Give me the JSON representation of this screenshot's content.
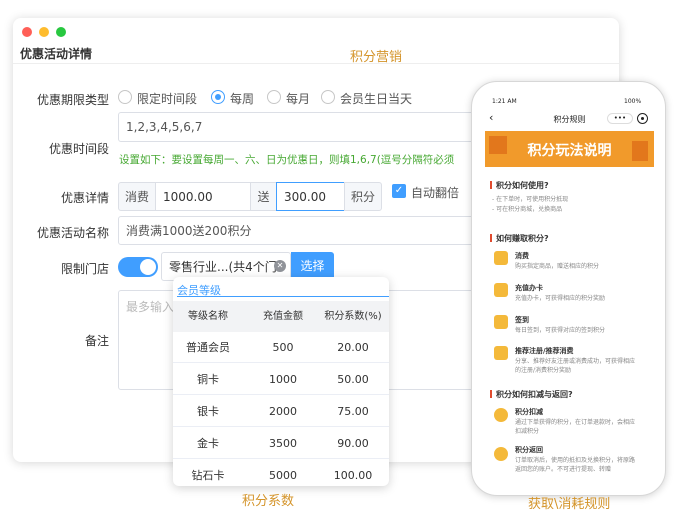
{
  "window": {
    "title": "优惠活动详情",
    "dots": [
      "#ff5f57",
      "#febc2e",
      "#28c840"
    ]
  },
  "captions": {
    "top": "积分营销",
    "coef": "积分系数",
    "rules": "获取\\消耗规则"
  },
  "form": {
    "period_type": {
      "label": "优惠期限类型",
      "options": [
        "限定时间段",
        "每周",
        "每月",
        "会员生日当天"
      ],
      "selected": "每周"
    },
    "time": {
      "label": "优惠时间段",
      "value": "1,2,3,4,5,6,7",
      "hint": "设置如下：要设置每周一、六、日为优惠日，则填1,6,7(逗号分隔符必须"
    },
    "detail": {
      "label": "优惠详情",
      "consume_label": "消费",
      "consume_value": "1000.00",
      "give_label": "送",
      "give_value": "300.00",
      "unit_label": "积分",
      "auto_double_label": "自动翻倍",
      "auto_double_checked": true
    },
    "name": {
      "label": "优惠活动名称",
      "value": "消费满1000送200积分"
    },
    "store": {
      "label": "限制门店",
      "value": "零售行业...(共4个门",
      "select_label": "选择",
      "enabled": true
    },
    "remark": {
      "label": "备注",
      "placeholder": "最多输入"
    }
  },
  "member_level": {
    "title": "会员等级",
    "headers": [
      "等级名称",
      "充值金额",
      "积分系数(%)"
    ],
    "rows": [
      [
        "普通会员",
        "500",
        "20.00"
      ],
      [
        "铜卡",
        "1000",
        "50.00"
      ],
      [
        "银卡",
        "2000",
        "75.00"
      ],
      [
        "金卡",
        "3500",
        "90.00"
      ],
      [
        "钻石卡",
        "5000",
        "100.00"
      ]
    ]
  },
  "phone": {
    "time": "1:21 AM",
    "battery": "100%",
    "nav_title": "积分规则",
    "banner": "积分玩法说明",
    "s1": {
      "title": "积分如何使用?",
      "lines": [
        "- 在下单时，可使用积分抵现",
        "- 可在积分商城，兑换商品"
      ]
    },
    "s2": {
      "title": "如何赚取积分?",
      "items": [
        {
          "title": "消费",
          "desc": [
            "购买指定商品，赠送相应的积分"
          ]
        },
        {
          "title": "充值办卡",
          "desc": [
            "充值办卡，可获得相应的积分奖励"
          ]
        },
        {
          "title": "签到",
          "desc": [
            "每日签到，可获得对应的签到积分"
          ]
        },
        {
          "title": "推荐注册/推荐消费",
          "desc": [
            "分享、推荐好友注册或消费成功，可获得相应",
            "的注册/消费积分奖励"
          ]
        }
      ]
    },
    "s3": {
      "title": "积分如何扣减与返回?",
      "items": [
        {
          "title": "积分扣减",
          "desc": [
            "通过下单获得的积分，在订单退款时，会相应",
            "扣减积分"
          ]
        },
        {
          "title": "积分返回",
          "desc": [
            "订单取消后，使用的抵扣及兑换积分，将原路",
            "返回您的账户。不可进行提现、转赠"
          ]
        }
      ]
    }
  }
}
